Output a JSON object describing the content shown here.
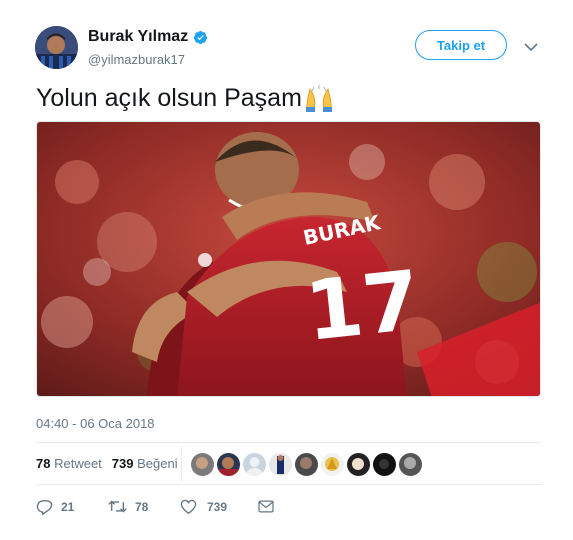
{
  "user": {
    "name": "Burak Yılmaz",
    "handle": "@yilmazburak17",
    "verified": true
  },
  "follow_button_label": "Takip et",
  "tweet": {
    "text": "Yolun açık olsun Paşam",
    "emoji": "folded-hands",
    "image_jersey_name": "BURAK",
    "image_jersey_number": "17"
  },
  "timestamp": "04:40 - 06 Oca 2018",
  "stats": {
    "retweet_count": "78",
    "retweet_label": "Retweet",
    "like_count": "739",
    "like_label": "Beğeni"
  },
  "actions": {
    "reply_count": "21",
    "retweet_count": "78",
    "like_count": "739"
  },
  "colors": {
    "accent": "#1da1f2",
    "secondary_text": "#657786",
    "primary_text": "#14171a"
  }
}
